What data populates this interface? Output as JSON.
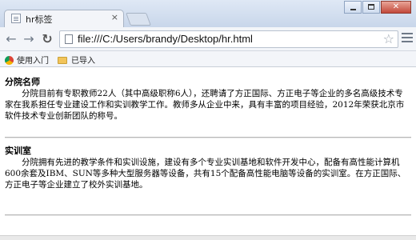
{
  "browser": {
    "tab_title": "hr标签",
    "tab_close": "×",
    "url": "file:///C:/Users/brandy/Desktop/hr.html",
    "bookmarks": [
      {
        "label": "使用入门",
        "icon": "chrome-logo-icon"
      },
      {
        "label": "已导入",
        "icon": "folder-icon"
      }
    ]
  },
  "page": {
    "sections": [
      {
        "title": "分院名师",
        "text": "分院目前有专职教师22人（其中高级职称6人），还聘请了方正国际、方正电子等企业的多名高级技术专家在我系担任专业建设工作和实训教学工作。教师多从企业中来，具有丰富的项目经验，2012年荣获北京市软件技术专业创新团队的称号。"
      },
      {
        "title": "实训室",
        "text": "分院拥有先进的教学条件和实训设施，建设有多个专业实训基地和软件开发中心，配备有高性能计算机600余套及IBM、SUN等多种大型服务器等设备，共有15个配备高性能电脑等设备的实训室。在方正国际、方正电子等企业建立了校外实训基地。"
      }
    ]
  }
}
